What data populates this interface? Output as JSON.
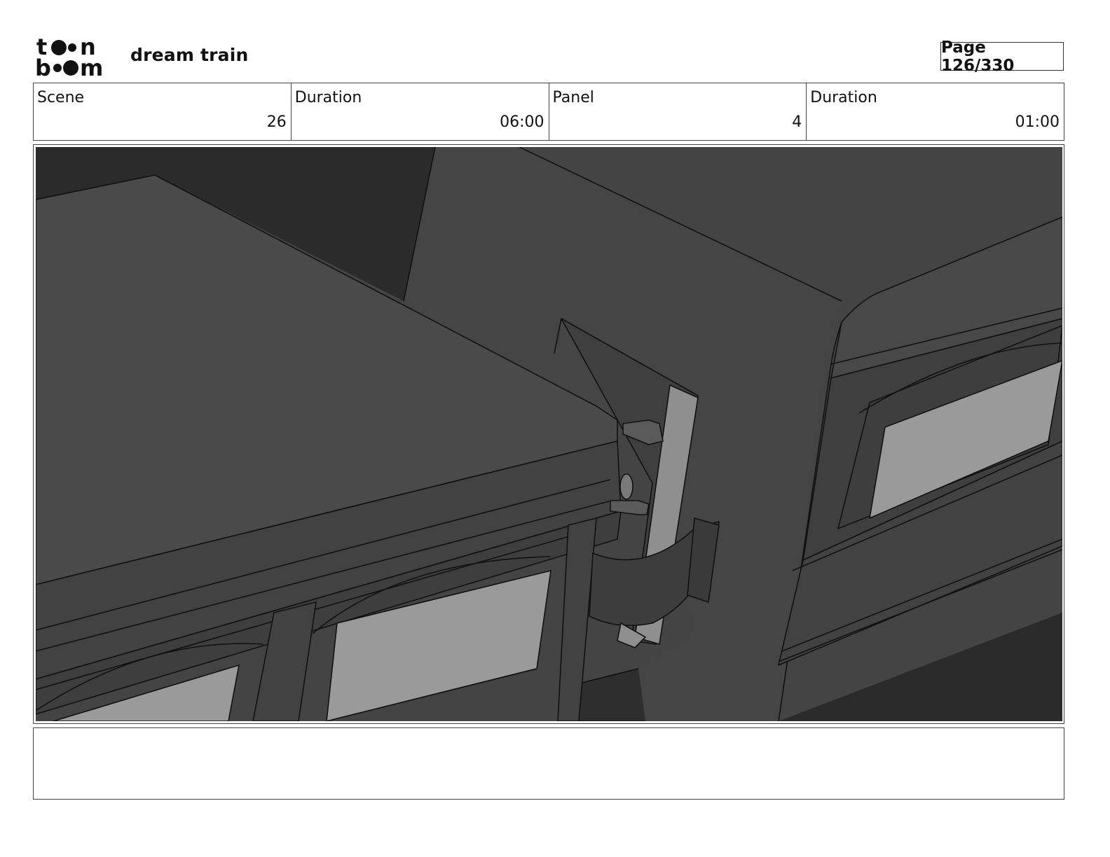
{
  "header": {
    "logo_text": "toon boom",
    "project_title": "dream train",
    "page_label": "Page 126/330"
  },
  "info": {
    "scene_label": "Scene",
    "scene_value": "26",
    "scene_duration_label": "Duration",
    "scene_duration_value": "06:00",
    "panel_label": "Panel",
    "panel_value": "4",
    "panel_duration_label": "Duration",
    "panel_duration_value": "01:00"
  },
  "notes": {
    "text": ""
  }
}
